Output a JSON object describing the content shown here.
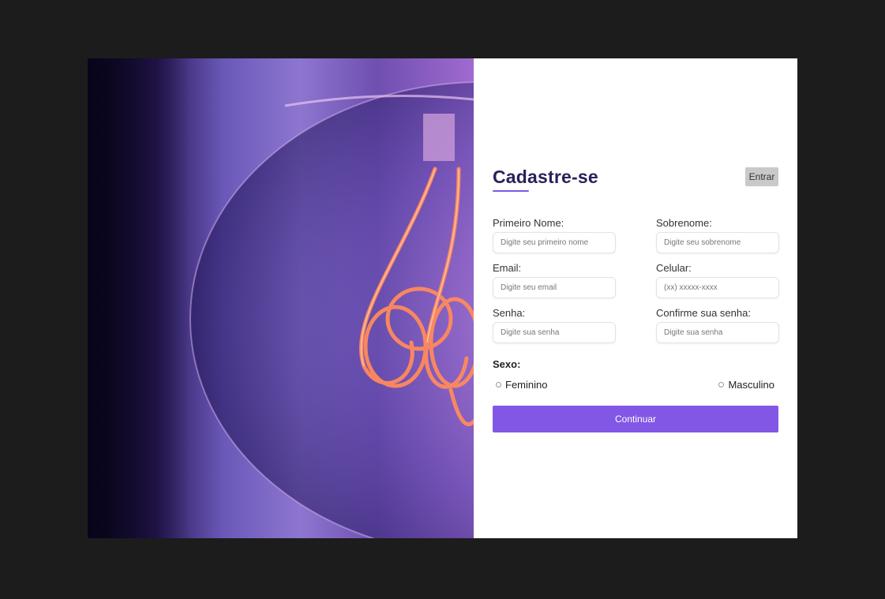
{
  "header": {
    "title": "Cadastre-se",
    "login_label": "Entrar"
  },
  "fields": [
    {
      "label": "Primeiro Nome:",
      "placeholder": "Digite seu primeiro nome"
    },
    {
      "label": "Sobrenome:",
      "placeholder": "Digite seu sobrenome"
    },
    {
      "label": "Email:",
      "placeholder": "Digite seu email"
    },
    {
      "label": "Celular:",
      "placeholder": "(xx) xxxxx-xxxx"
    },
    {
      "label": "Senha:",
      "placeholder": "Digite sua senha"
    },
    {
      "label": "Confirme sua senha:",
      "placeholder": "Digite sua senha"
    }
  ],
  "gender": {
    "label": "Sexo:",
    "options": [
      "Feminino",
      "Masculino"
    ]
  },
  "submit_label": "Continuar",
  "colors": {
    "accent": "#8257e5",
    "title": "#2b2158",
    "page_background": "#1c1c1c"
  },
  "hero_image": "glowing-filament-bulb-photo"
}
